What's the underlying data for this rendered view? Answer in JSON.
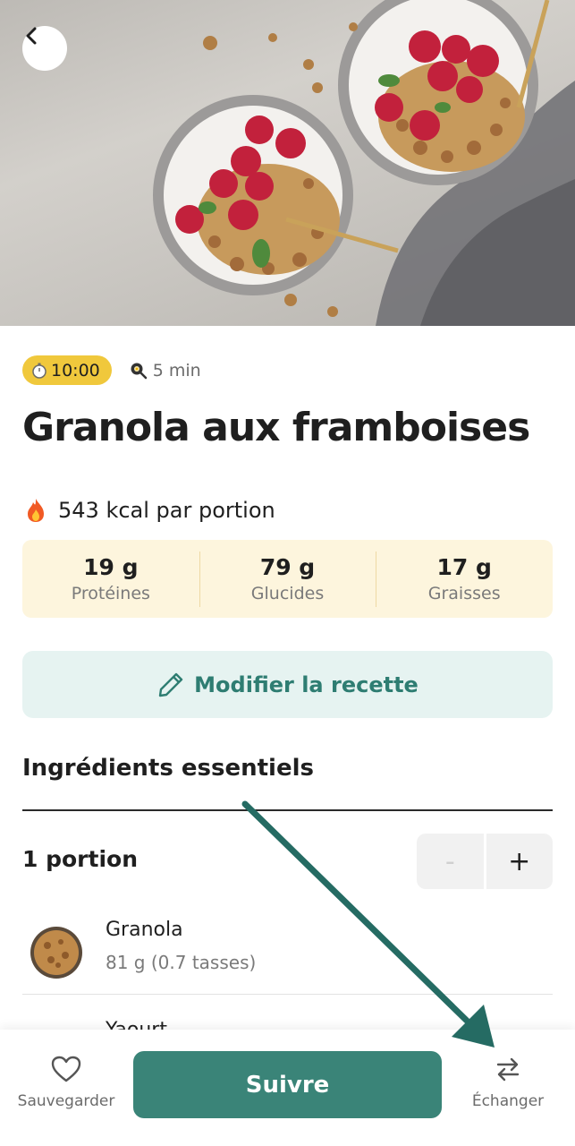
{
  "header": {
    "back_icon": "chevron-left-icon",
    "hero_image": "granola-raspberry-bowls-photo"
  },
  "meta": {
    "time_badge": "10:00",
    "time_icon": "stopwatch-icon",
    "prep_time": "5 min",
    "prep_icon": "cooking-pan-icon",
    "badge_color": "#f0c83c"
  },
  "recipe": {
    "title": "Granola aux framboises",
    "kcal_text": "543 kcal par portion",
    "kcal_icon": "fire-icon"
  },
  "macros": [
    {
      "value": "19 g",
      "label": "Protéines"
    },
    {
      "value": "79 g",
      "label": "Glucides"
    },
    {
      "value": "17 g",
      "label": "Graisses"
    }
  ],
  "edit_button": {
    "label": "Modifier la recette",
    "icon": "pencil-icon"
  },
  "ingredients_section": {
    "title": "Ingrédients essentiels",
    "portion_label": "1 portion",
    "minus": "-",
    "plus": "+",
    "items": [
      {
        "name": "Granola",
        "quantity": "81 g (0.7 tasses)"
      },
      {
        "name": "Yaourt",
        "quantity": ""
      }
    ]
  },
  "bottom_bar": {
    "save_label": "Sauvegarder",
    "save_icon": "heart-outline-icon",
    "follow_label": "Suivre",
    "swap_label": "Échanger",
    "swap_icon": "swap-arrows-icon"
  },
  "colors": {
    "accent": "#3a8478",
    "accent_light": "#e6f3f1",
    "macro_bg": "#fdf5dd",
    "annotation_arrow": "#256b63"
  }
}
